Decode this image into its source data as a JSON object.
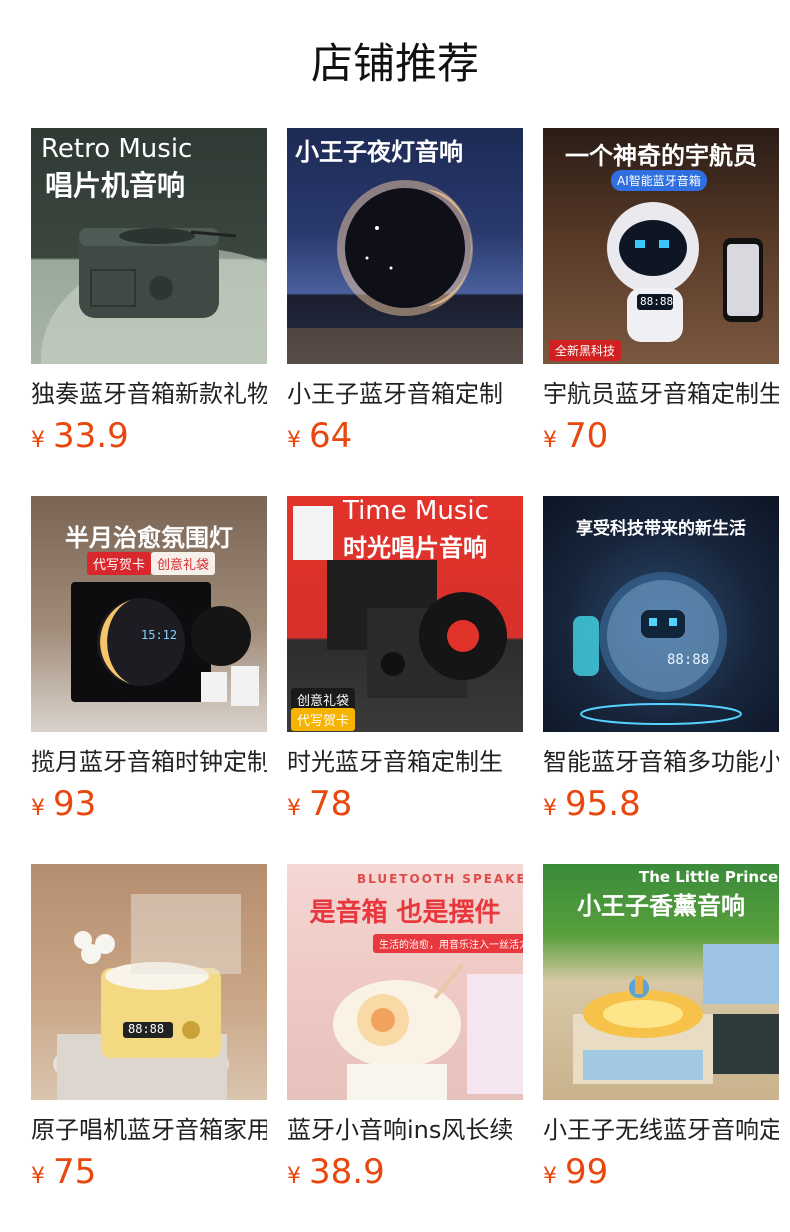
{
  "page": {
    "title": "店铺推荐"
  },
  "currency_symbol": "¥",
  "products": [
    {
      "name": "独奏蓝牙音箱新款礼物",
      "price": "33.9",
      "image_text": {
        "title_en": "Retro Music",
        "title_cn": "唱片机音响"
      }
    },
    {
      "name": "小王子蓝牙音箱定制",
      "price": "64",
      "image_text": {
        "title_cn": "小王子夜灯音响"
      }
    },
    {
      "name": "宇航员蓝牙音箱定制生",
      "price": "70",
      "image_text": {
        "title_cn": "一个神奇的宇航员",
        "badge": "AI智能蓝牙音箱",
        "tag": "全新黑科技",
        "display": "88:88"
      }
    },
    {
      "name": "揽月蓝牙音箱时钟定制",
      "price": "93",
      "image_text": {
        "title_cn": "半月治愈氛围灯",
        "tag1": "代写贺卡",
        "tag2": "创意礼袋",
        "display": "15:12"
      }
    },
    {
      "name": "时光蓝牙音箱定制生",
      "price": "78",
      "image_text": {
        "title_en": "Time Music",
        "title_cn": "时光唱片音响",
        "tag1": "创意礼袋",
        "tag2": "代写贺卡"
      }
    },
    {
      "name": "智能蓝牙音箱多功能小",
      "price": "95.8",
      "image_text": {
        "title_cn": "享受科技带来的新生活",
        "display": "88:88"
      }
    },
    {
      "name": "原子唱机蓝牙音箱家用",
      "price": "75",
      "image_text": {
        "display": "88:88"
      }
    },
    {
      "name": "蓝牙小音响ins风长续",
      "price": "38.9",
      "image_text": {
        "title_en": "BLUETOOTH SPEAKER",
        "title_cn": "是音箱 也是摆件",
        "sub": "生活的治愈，用音乐注入一丝活力"
      }
    },
    {
      "name": "小王子无线蓝牙音响定",
      "price": "99",
      "image_text": {
        "title_en": "The Little Prince",
        "title_cn": "小王子香薰音响"
      }
    }
  ]
}
